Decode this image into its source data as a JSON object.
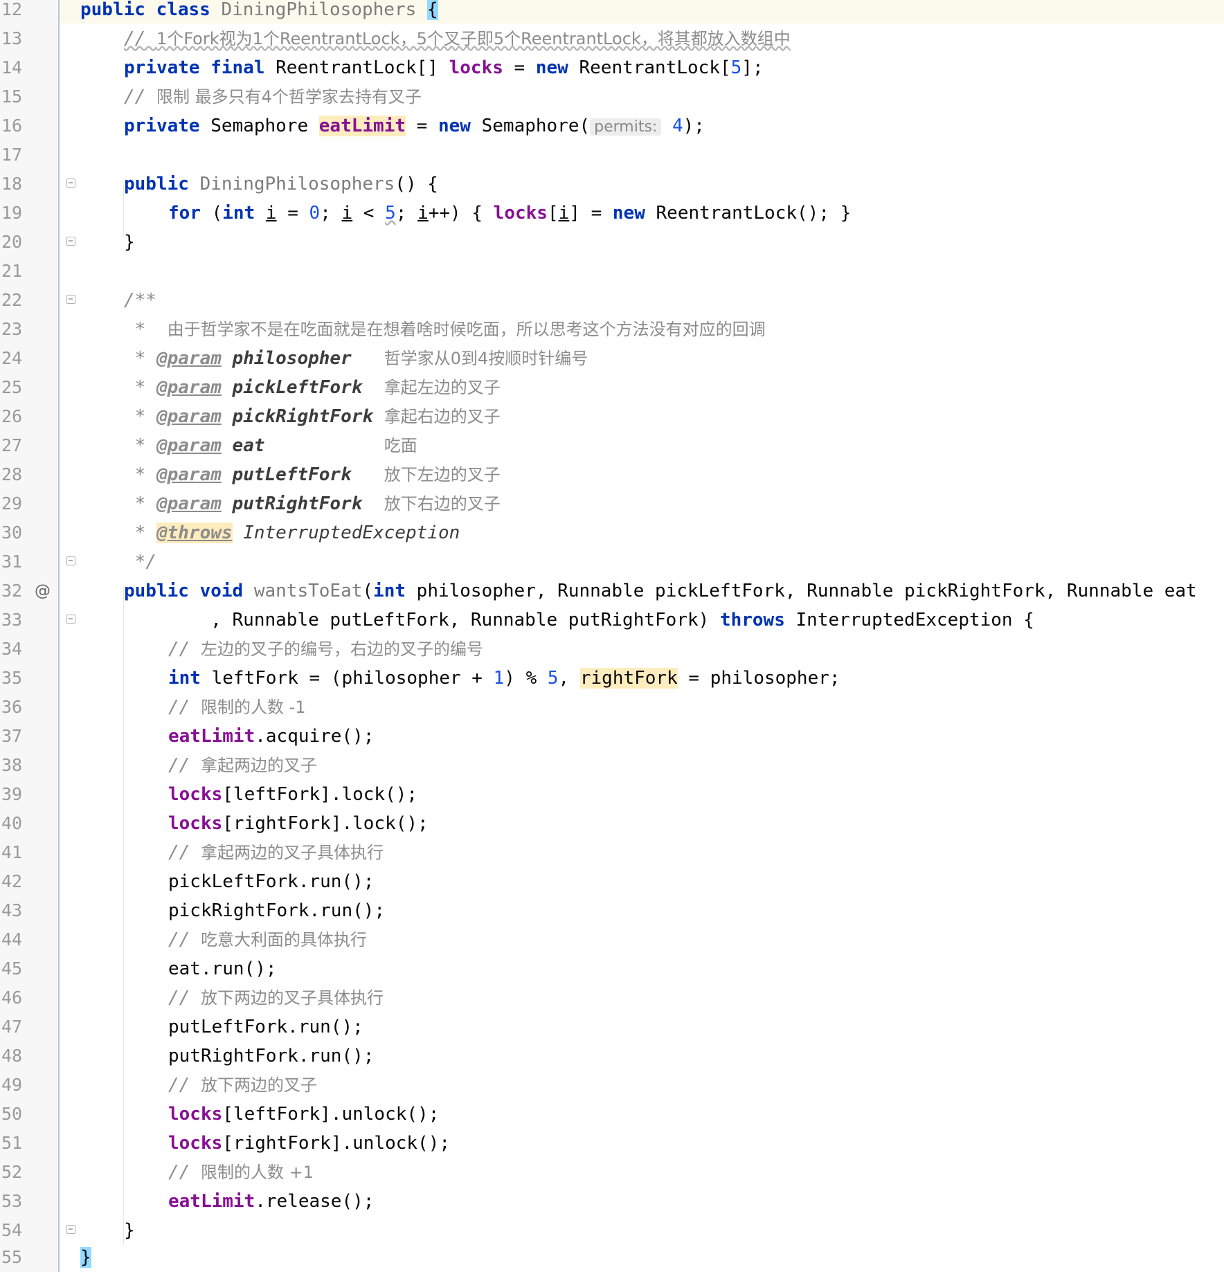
{
  "editor": {
    "colors": {
      "keyword": "#0033b3",
      "field": "#871094",
      "number": "#1750eb",
      "comment": "#8c8c8c",
      "highlight": "#fdecbe",
      "current_line": "#fcfaed"
    },
    "override_icon": "@",
    "hint_label": "permits:",
    "lines": {
      "l12": {
        "n": "12",
        "kw": "public class ",
        "name": "DiningPhilosophers ",
        "brace": "{"
      },
      "l13": {
        "n": "13",
        "c1": "// ",
        "c2": "1个Fork视为1个ReentrantLock，5个叉子即5个ReentrantLock，将其都放入数组中"
      },
      "l14": {
        "n": "14",
        "kw": "private final ",
        "t1": "ReentrantLock[] ",
        "fld": "locks",
        "t2": " = ",
        "kw2": "new",
        "t3": " ReentrantLock[",
        "num": "5",
        "t4": "];"
      },
      "l15": {
        "n": "15",
        "c1": "// ",
        "c2": "限制 最多只有4个哲学家去持有叉子"
      },
      "l16": {
        "n": "16",
        "kw": "private ",
        "t1": "Semaphore ",
        "fld": "eatLimit",
        "t2": " = ",
        "kw2": "new",
        "t3": " Semaphore(",
        "num": "4",
        "t4": ");"
      },
      "l17": {
        "n": "17"
      },
      "l18": {
        "n": "18",
        "kw": "public ",
        "name": "DiningPhilosophers",
        "t1": "() {"
      },
      "l19": {
        "n": "19",
        "kw": "for",
        "t1": " (",
        "kw2": "int",
        "t2": " ",
        "v1": "i",
        "t3": " = ",
        "num1": "0",
        "t4": "; ",
        "v2": "i",
        "t5": " < ",
        "num2": "5",
        "t6": "; ",
        "v3": "i",
        "t7": "++) { ",
        "fld": "locks",
        "t8": "[",
        "v4": "i",
        "t9": "] = ",
        "kw3": "new",
        "t10": " ReentrantLock(); }"
      },
      "l20": {
        "n": "20",
        "t1": "}"
      },
      "l21": {
        "n": "21"
      },
      "l22": {
        "n": "22",
        "t1": "/**"
      },
      "l23": {
        "n": "23",
        "t1": " *  ",
        "c2": "由于哲学家不是在吃面就是在想着啥时候吃面，所以思考这个方法没有对应的回调"
      },
      "l24": {
        "n": "24",
        "star": " * ",
        "tag": "@param",
        "sp": " ",
        "p": "philosopher",
        "pad": "   ",
        "d": "哲学家从0到4按顺时针编号"
      },
      "l25": {
        "n": "25",
        "star": " * ",
        "tag": "@param",
        "sp": " ",
        "p": "pickLeftFork",
        "pad": "  ",
        "d": "拿起左边的叉子"
      },
      "l26": {
        "n": "26",
        "star": " * ",
        "tag": "@param",
        "sp": " ",
        "p": "pickRightFork",
        "pad": " ",
        "d": "拿起右边的叉子"
      },
      "l27": {
        "n": "27",
        "star": " * ",
        "tag": "@param",
        "sp": " ",
        "p": "eat",
        "pad": "           ",
        "d": "吃面"
      },
      "l28": {
        "n": "28",
        "star": " * ",
        "tag": "@param",
        "sp": " ",
        "p": "putLeftFork",
        "pad": "   ",
        "d": "放下左边的叉子"
      },
      "l29": {
        "n": "29",
        "star": " * ",
        "tag": "@param",
        "sp": " ",
        "p": "putRightFork",
        "pad": "  ",
        "d": "放下右边的叉子"
      },
      "l30": {
        "n": "30",
        "star": " * ",
        "tag": "@throws",
        "sp": " ",
        "ref": "InterruptedException"
      },
      "l31": {
        "n": "31",
        "t1": " */"
      },
      "l32": {
        "n": "32",
        "kw": "public void ",
        "name": "wantsToEat",
        "t1": "(",
        "kw2": "int",
        "t2": " philosopher, Runnable pickLeftFork, Runnable pickRightFork, Runnable eat"
      },
      "l33": {
        "n": "33",
        "t1": "        , Runnable putLeftFork, Runnable putRightFork) ",
        "kw": "throws",
        "t2": " InterruptedException {"
      },
      "l34": {
        "n": "34",
        "c1": "// ",
        "c2": "左边的叉子的编号，右边的叉子的编号"
      },
      "l35": {
        "n": "35",
        "kw": "int",
        "t1": " leftFork = (philosopher + ",
        "num1": "1",
        "t2": ") % ",
        "num2": "5",
        "t3": ", ",
        "hl": "rightFork",
        "t4": " = philosopher;"
      },
      "l36": {
        "n": "36",
        "c1": "// ",
        "c2": "限制的人数 -1"
      },
      "l37": {
        "n": "37",
        "fld": "eatLimit",
        "t1": ".acquire();"
      },
      "l38": {
        "n": "38",
        "c1": "// ",
        "c2": "拿起两边的叉子"
      },
      "l39": {
        "n": "39",
        "fld": "locks",
        "t1": "[leftFork].lock();"
      },
      "l40": {
        "n": "40",
        "fld": "locks",
        "t1": "[rightFork].lock();"
      },
      "l41": {
        "n": "41",
        "c1": "// ",
        "c2": "拿起两边的叉子具体执行"
      },
      "l42": {
        "n": "42",
        "t1": "pickLeftFork.run();"
      },
      "l43": {
        "n": "43",
        "t1": "pickRightFork.run();"
      },
      "l44": {
        "n": "44",
        "c1": "// ",
        "c2": "吃意大利面的具体执行"
      },
      "l45": {
        "n": "45",
        "t1": "eat.run();"
      },
      "l46": {
        "n": "46",
        "c1": "// ",
        "c2": "放下两边的叉子具体执行"
      },
      "l47": {
        "n": "47",
        "t1": "putLeftFork.run();"
      },
      "l48": {
        "n": "48",
        "t1": "putRightFork.run();"
      },
      "l49": {
        "n": "49",
        "c1": "// ",
        "c2": "放下两边的叉子"
      },
      "l50": {
        "n": "50",
        "fld": "locks",
        "t1": "[leftFork].unlock();"
      },
      "l51": {
        "n": "51",
        "fld": "locks",
        "t1": "[rightFork].unlock();"
      },
      "l52": {
        "n": "52",
        "c1": "// ",
        "c2": "限制的人数 +1"
      },
      "l53": {
        "n": "53",
        "fld": "eatLimit",
        "t1": ".release();"
      },
      "l54": {
        "n": "54",
        "t1": "}"
      },
      "l55": {
        "n": "55",
        "brace": "}"
      }
    }
  }
}
